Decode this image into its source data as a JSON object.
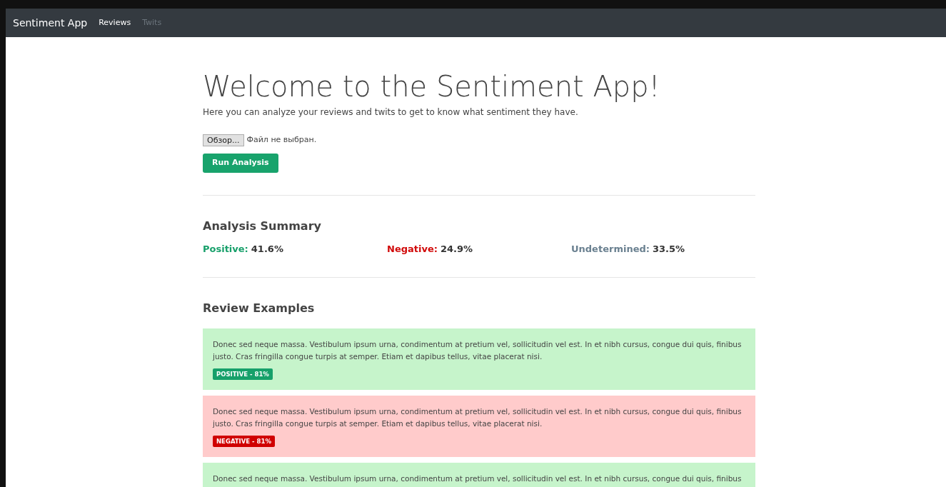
{
  "navbar": {
    "brand": "Sentiment App",
    "links": [
      {
        "label": "Reviews",
        "selected": true
      },
      {
        "label": "Twits",
        "selected": false
      }
    ]
  },
  "header": {
    "title": "Welcome to the Sentiment App!",
    "subtitle": "Here you can analyze your reviews and twits to get to know what sentiment they have."
  },
  "file_input": {
    "button": "Обзор...",
    "status": "Файл не выбран."
  },
  "run_button": "Run Analysis",
  "summary": {
    "title": "Analysis Summary",
    "items": [
      {
        "kind": "positive",
        "label": "Positive:",
        "value": "41.6%"
      },
      {
        "kind": "negative",
        "label": "Negative:",
        "value": "24.9%"
      },
      {
        "kind": "undetermined",
        "label": "Undetermined:",
        "value": "33.5%"
      }
    ]
  },
  "examples": {
    "title": "Review Examples",
    "items": [
      {
        "kind": "positive",
        "text": "Donec sed neque massa. Vestibulum ipsum urna, condimentum at pretium vel, sollicitudin vel est. In et nibh cursus, congue dui quis, finibus justo. Cras fringilla congue turpis at semper. Etiam et dapibus tellus, vitae placerat nisi.",
        "badge": "POSITIVE - 81%"
      },
      {
        "kind": "negative",
        "text": "Donec sed neque massa. Vestibulum ipsum urna, condimentum at pretium vel, sollicitudin vel est. In et nibh cursus, congue dui quis, finibus justo. Cras fringilla congue turpis at semper. Etiam et dapibus tellus, vitae placerat nisi.",
        "badge": "NEGATIVE - 81%"
      },
      {
        "kind": "positive",
        "text": "Donec sed neque massa. Vestibulum ipsum urna, condimentum at pretium vel, sollicitudin vel est. In et nibh cursus, congue dui quis, finibus"
      }
    ]
  }
}
